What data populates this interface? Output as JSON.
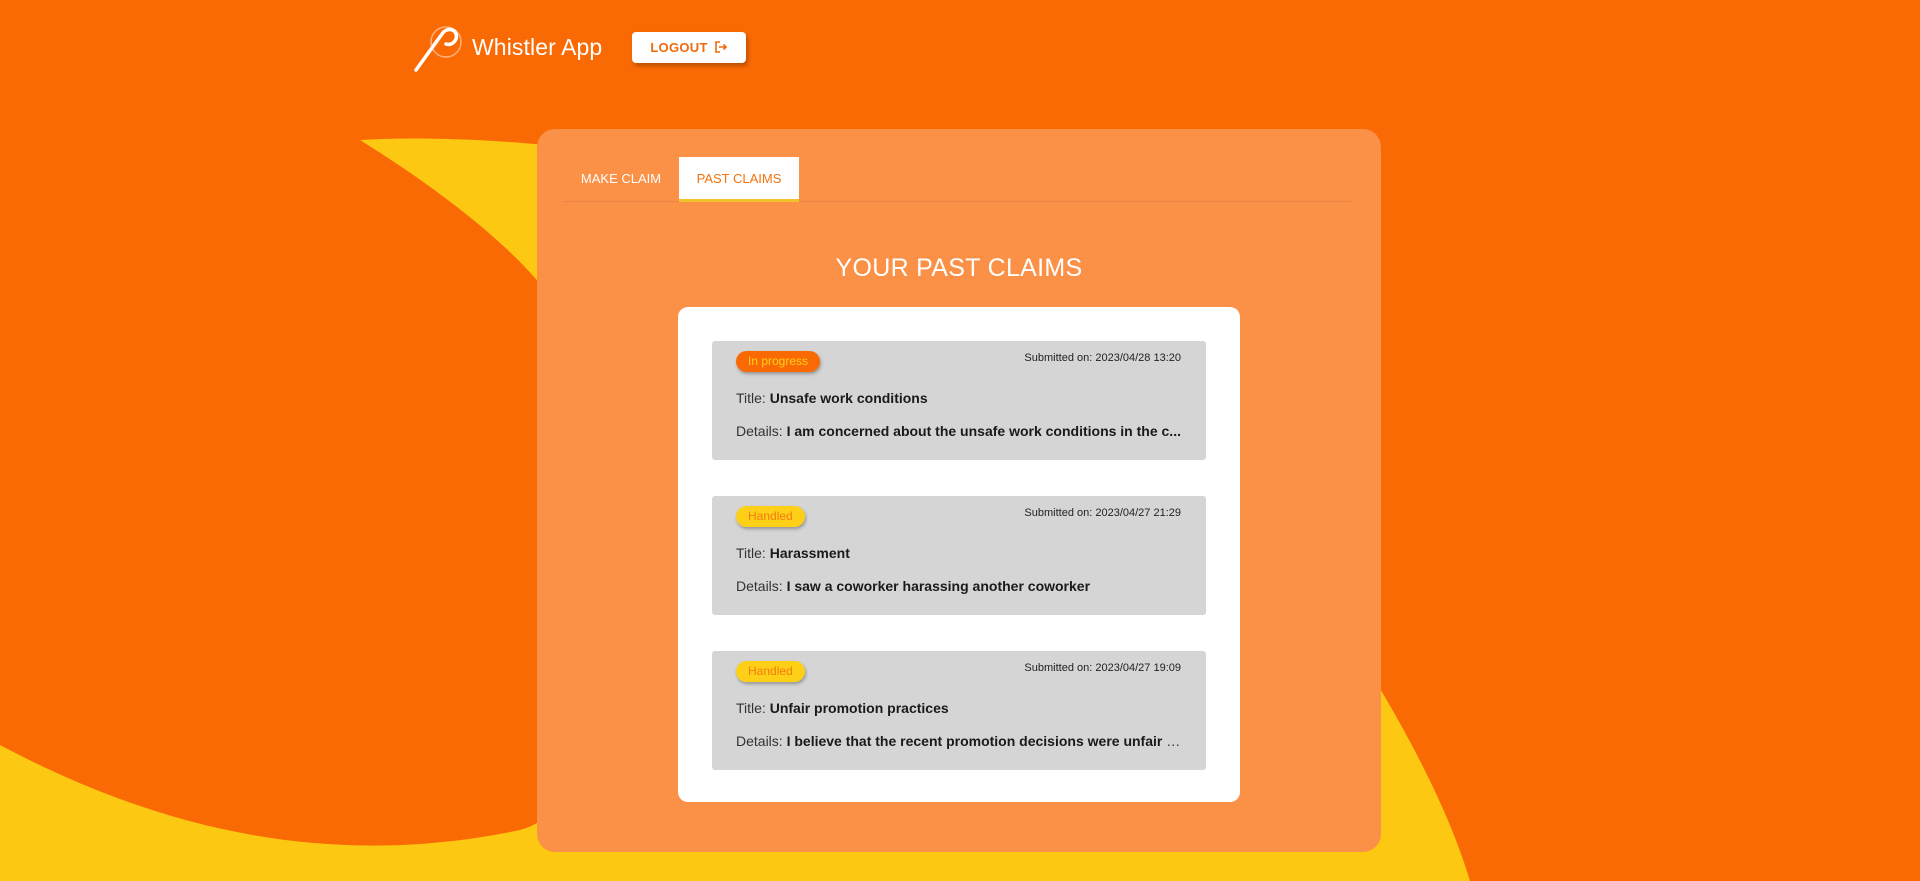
{
  "header": {
    "app_title": "Whistler App",
    "logout_label": "LOGOUT"
  },
  "tabs": [
    {
      "label": "MAKE CLAIM",
      "active": false
    },
    {
      "label": "PAST CLAIMS",
      "active": true
    }
  ],
  "main": {
    "title": "YOUR PAST CLAIMS",
    "title_prefix": "Title:",
    "details_prefix": "Details:",
    "claims": [
      {
        "status": "In progress",
        "submitted": "Submitted on: 2023/04/28 13:20",
        "title": "Unsafe work conditions",
        "details": "I am concerned about the unsafe work conditions in the c..."
      },
      {
        "status": "Handled",
        "submitted": "Submitted on: 2023/04/27 21:29",
        "title": "Harassment",
        "details": "I saw a coworker harassing another coworker"
      },
      {
        "status": "Handled",
        "submitted": "Submitted on: 2023/04/27 19:09",
        "title": "Unfair promotion practices",
        "details": "I believe that the recent promotion decisions were unfair a..."
      }
    ]
  },
  "colors": {
    "background": "#fa6a04",
    "accent_yellow": "#fdc811",
    "panel": "#fb9047",
    "card": "#d5d5d5",
    "badge_in_progress": "#fa6a04",
    "badge_handled": "#fdd017"
  },
  "icons": {
    "logo": "whistle-logo-icon",
    "logout": "logout-icon"
  }
}
